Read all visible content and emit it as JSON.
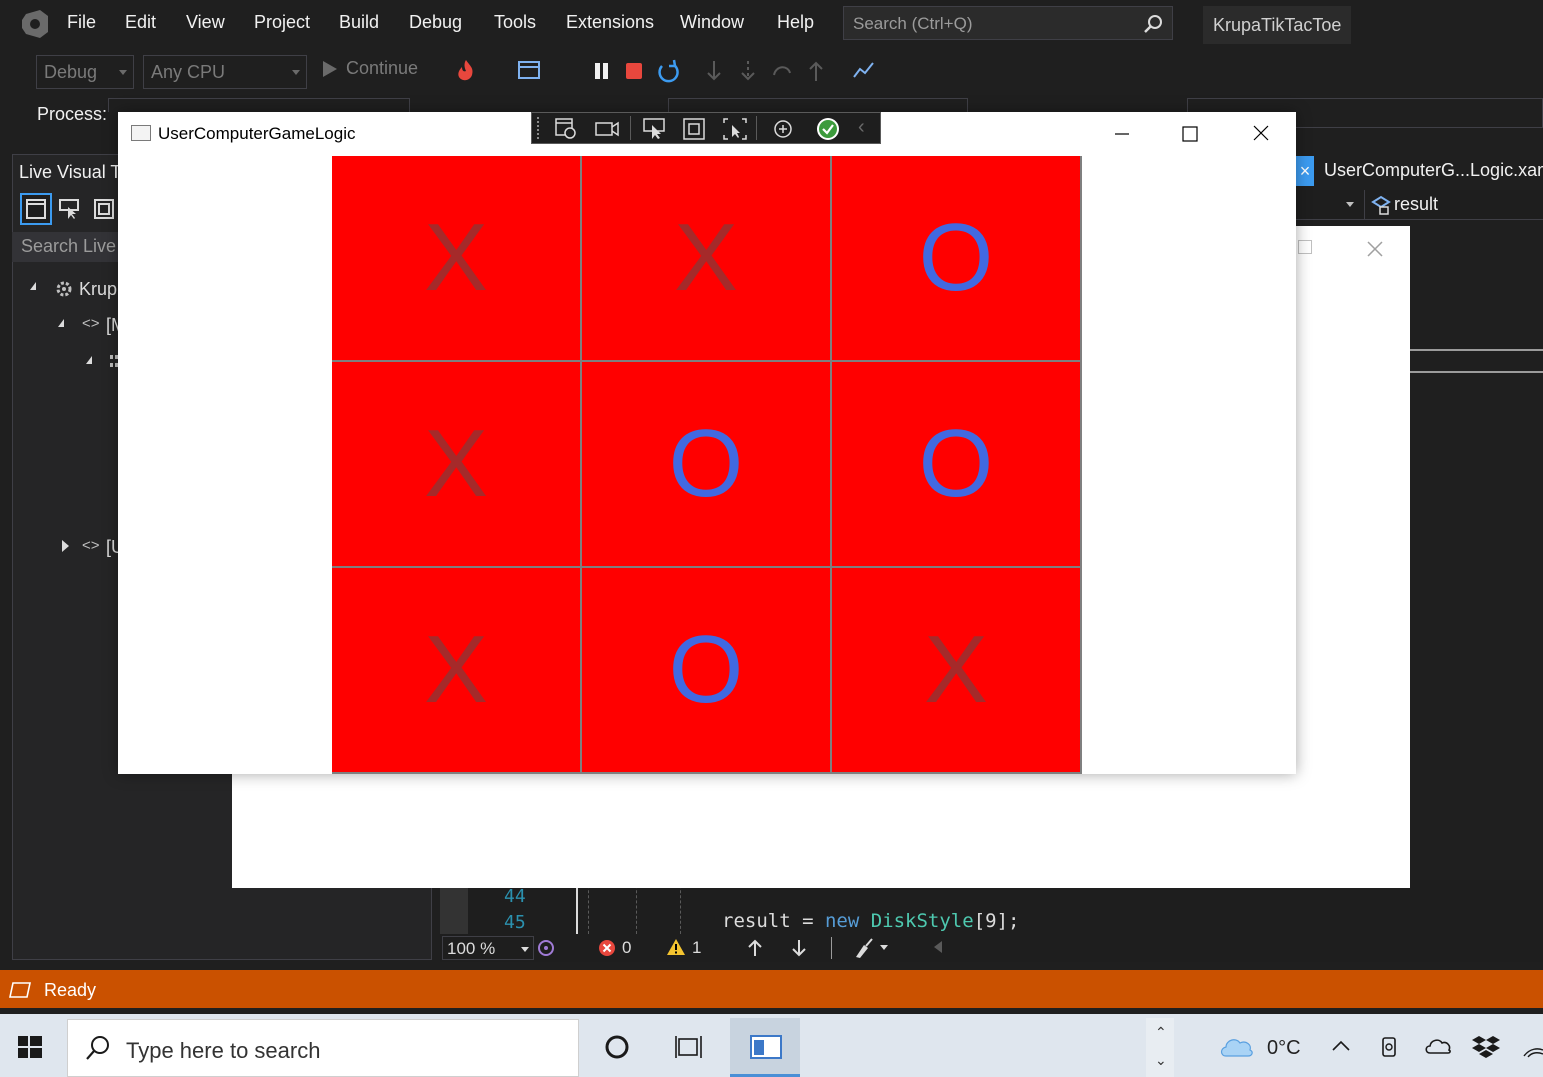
{
  "menubar": {
    "items": [
      "File",
      "Edit",
      "View",
      "Project",
      "Build",
      "Debug",
      "Tools",
      "Extensions",
      "Window",
      "Help"
    ],
    "search_placeholder": "Search (Ctrl+Q)",
    "solution_name": "KrupaTikTacToe"
  },
  "toolbar": {
    "config": "Debug",
    "platform": "Any CPU",
    "continue_label": "Continue"
  },
  "process": {
    "label": "Process:"
  },
  "live_visual_tree": {
    "title": "Live Visual Tr",
    "search_placeholder": "Search Live V",
    "nodes": [
      "Krup",
      "[M",
      "[U"
    ]
  },
  "editor": {
    "tab_label": "UserComputerG...Logic.xam",
    "nav_member": "result",
    "line_numbers": [
      "44",
      "45"
    ],
    "code_line": {
      "name": "result",
      "op": " = ",
      "keyword": "new",
      "type": " DiskStyle",
      "rest": "[9];"
    },
    "zoom": "100 %",
    "errors": "0",
    "warnings": "1"
  },
  "app_window": {
    "title": "UserComputerGameLogic",
    "board": [
      [
        "X",
        "X",
        "O"
      ],
      [
        "X",
        "O",
        "O"
      ],
      [
        "X",
        "O",
        "X"
      ]
    ],
    "colors": {
      "cell": "#ff0000",
      "x": "#a52a2a",
      "o": "#4169e1"
    }
  },
  "statusbar": {
    "text": "Ready",
    "color": "#ca5100"
  },
  "taskbar": {
    "search_placeholder": "Type here to search",
    "temperature": "0°C"
  }
}
